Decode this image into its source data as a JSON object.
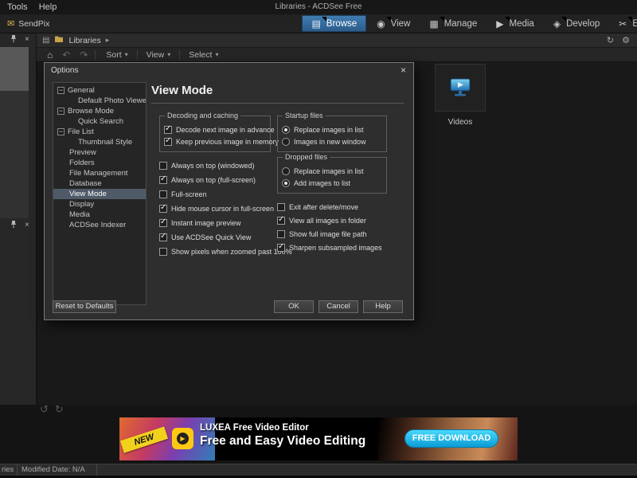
{
  "titlebar": {
    "menus": [
      "Tools",
      "Help"
    ],
    "title": "Libraries - ACDSee Free"
  },
  "modebar": {
    "sendpix_label": "SendPix",
    "tabs": [
      {
        "label": "Browse",
        "icon": "browse-grid",
        "active": true
      },
      {
        "label": "View",
        "icon": "eye",
        "active": false
      },
      {
        "label": "Manage",
        "icon": "manage-grid",
        "active": false
      },
      {
        "label": "Media",
        "icon": "media-play",
        "active": false
      },
      {
        "label": "Develop",
        "icon": "develop-diamond",
        "active": false
      },
      {
        "label": "E",
        "icon": "scissors",
        "active": false
      }
    ]
  },
  "breadcrumb": {
    "location": "Libraries"
  },
  "toolbar": {
    "items": [
      "Sort",
      "View",
      "Select"
    ]
  },
  "browser": {
    "folder_tile_label": "Videos"
  },
  "dialog": {
    "title": "Options",
    "page_title": "View Mode",
    "tree": [
      {
        "label": "General",
        "level": 0,
        "expandable": true
      },
      {
        "label": "Default Photo Viewer",
        "level": 1
      },
      {
        "label": "Browse Mode",
        "level": 0,
        "expandable": true
      },
      {
        "label": "Quick Search",
        "level": 1
      },
      {
        "label": "File List",
        "level": 0,
        "expandable": true
      },
      {
        "label": "Thumbnail Style",
        "level": 1
      },
      {
        "label": "Preview",
        "level": 0
      },
      {
        "label": "Folders",
        "level": 0
      },
      {
        "label": "File Management",
        "level": 0
      },
      {
        "label": "Database",
        "level": 0
      },
      {
        "label": "View Mode",
        "level": 0,
        "selected": true
      },
      {
        "label": "Display",
        "level": 0
      },
      {
        "label": "Media",
        "level": 0
      },
      {
        "label": "ACDSee Indexer",
        "level": 0
      }
    ],
    "decoding_group": {
      "title": "Decoding and caching",
      "checks": [
        {
          "label": "Decode next image in advance",
          "checked": true
        },
        {
          "label": "Keep previous image in memory",
          "checked": true
        }
      ]
    },
    "startup_group": {
      "title": "Startup files",
      "radios": [
        {
          "label": "Replace images in list",
          "selected": true
        },
        {
          "label": "Images in new window",
          "selected": false
        }
      ]
    },
    "dropped_group": {
      "title": "Dropped files",
      "radios": [
        {
          "label": "Replace images in list",
          "selected": false
        },
        {
          "label": "Add images to list",
          "selected": true
        }
      ]
    },
    "left_checks": [
      {
        "label": "Always on top (windowed)",
        "checked": false
      },
      {
        "label": "Always on top (full-screen)",
        "checked": true
      },
      {
        "label": "Full-screen",
        "checked": false
      },
      {
        "label": "Hide mouse cursor in full-screen",
        "checked": true
      },
      {
        "label": "Instant image preview",
        "checked": true
      },
      {
        "label": "Use ACDSee Quick View",
        "checked": true
      },
      {
        "label": "Show pixels when zoomed past 100%",
        "checked": false
      }
    ],
    "right_checks": [
      {
        "label": "Exit after delete/move",
        "checked": false
      },
      {
        "label": "View all images in folder",
        "checked": true
      },
      {
        "label": "Show full image file path",
        "checked": false
      },
      {
        "label": "Sharpen subsampled images",
        "checked": true
      }
    ],
    "buttons": {
      "reset": "Reset to Defaults",
      "ok": "OK",
      "cancel": "Cancel",
      "help": "Help"
    }
  },
  "ad": {
    "new_badge": "NEW",
    "title": "LUXEA Free Video Editor",
    "subtitle": "Free and Easy Video Editing",
    "cta": "FREE DOWNLOAD"
  },
  "statusbar": {
    "left_text": "ries",
    "modified_text": "Modified Date: N/A"
  }
}
